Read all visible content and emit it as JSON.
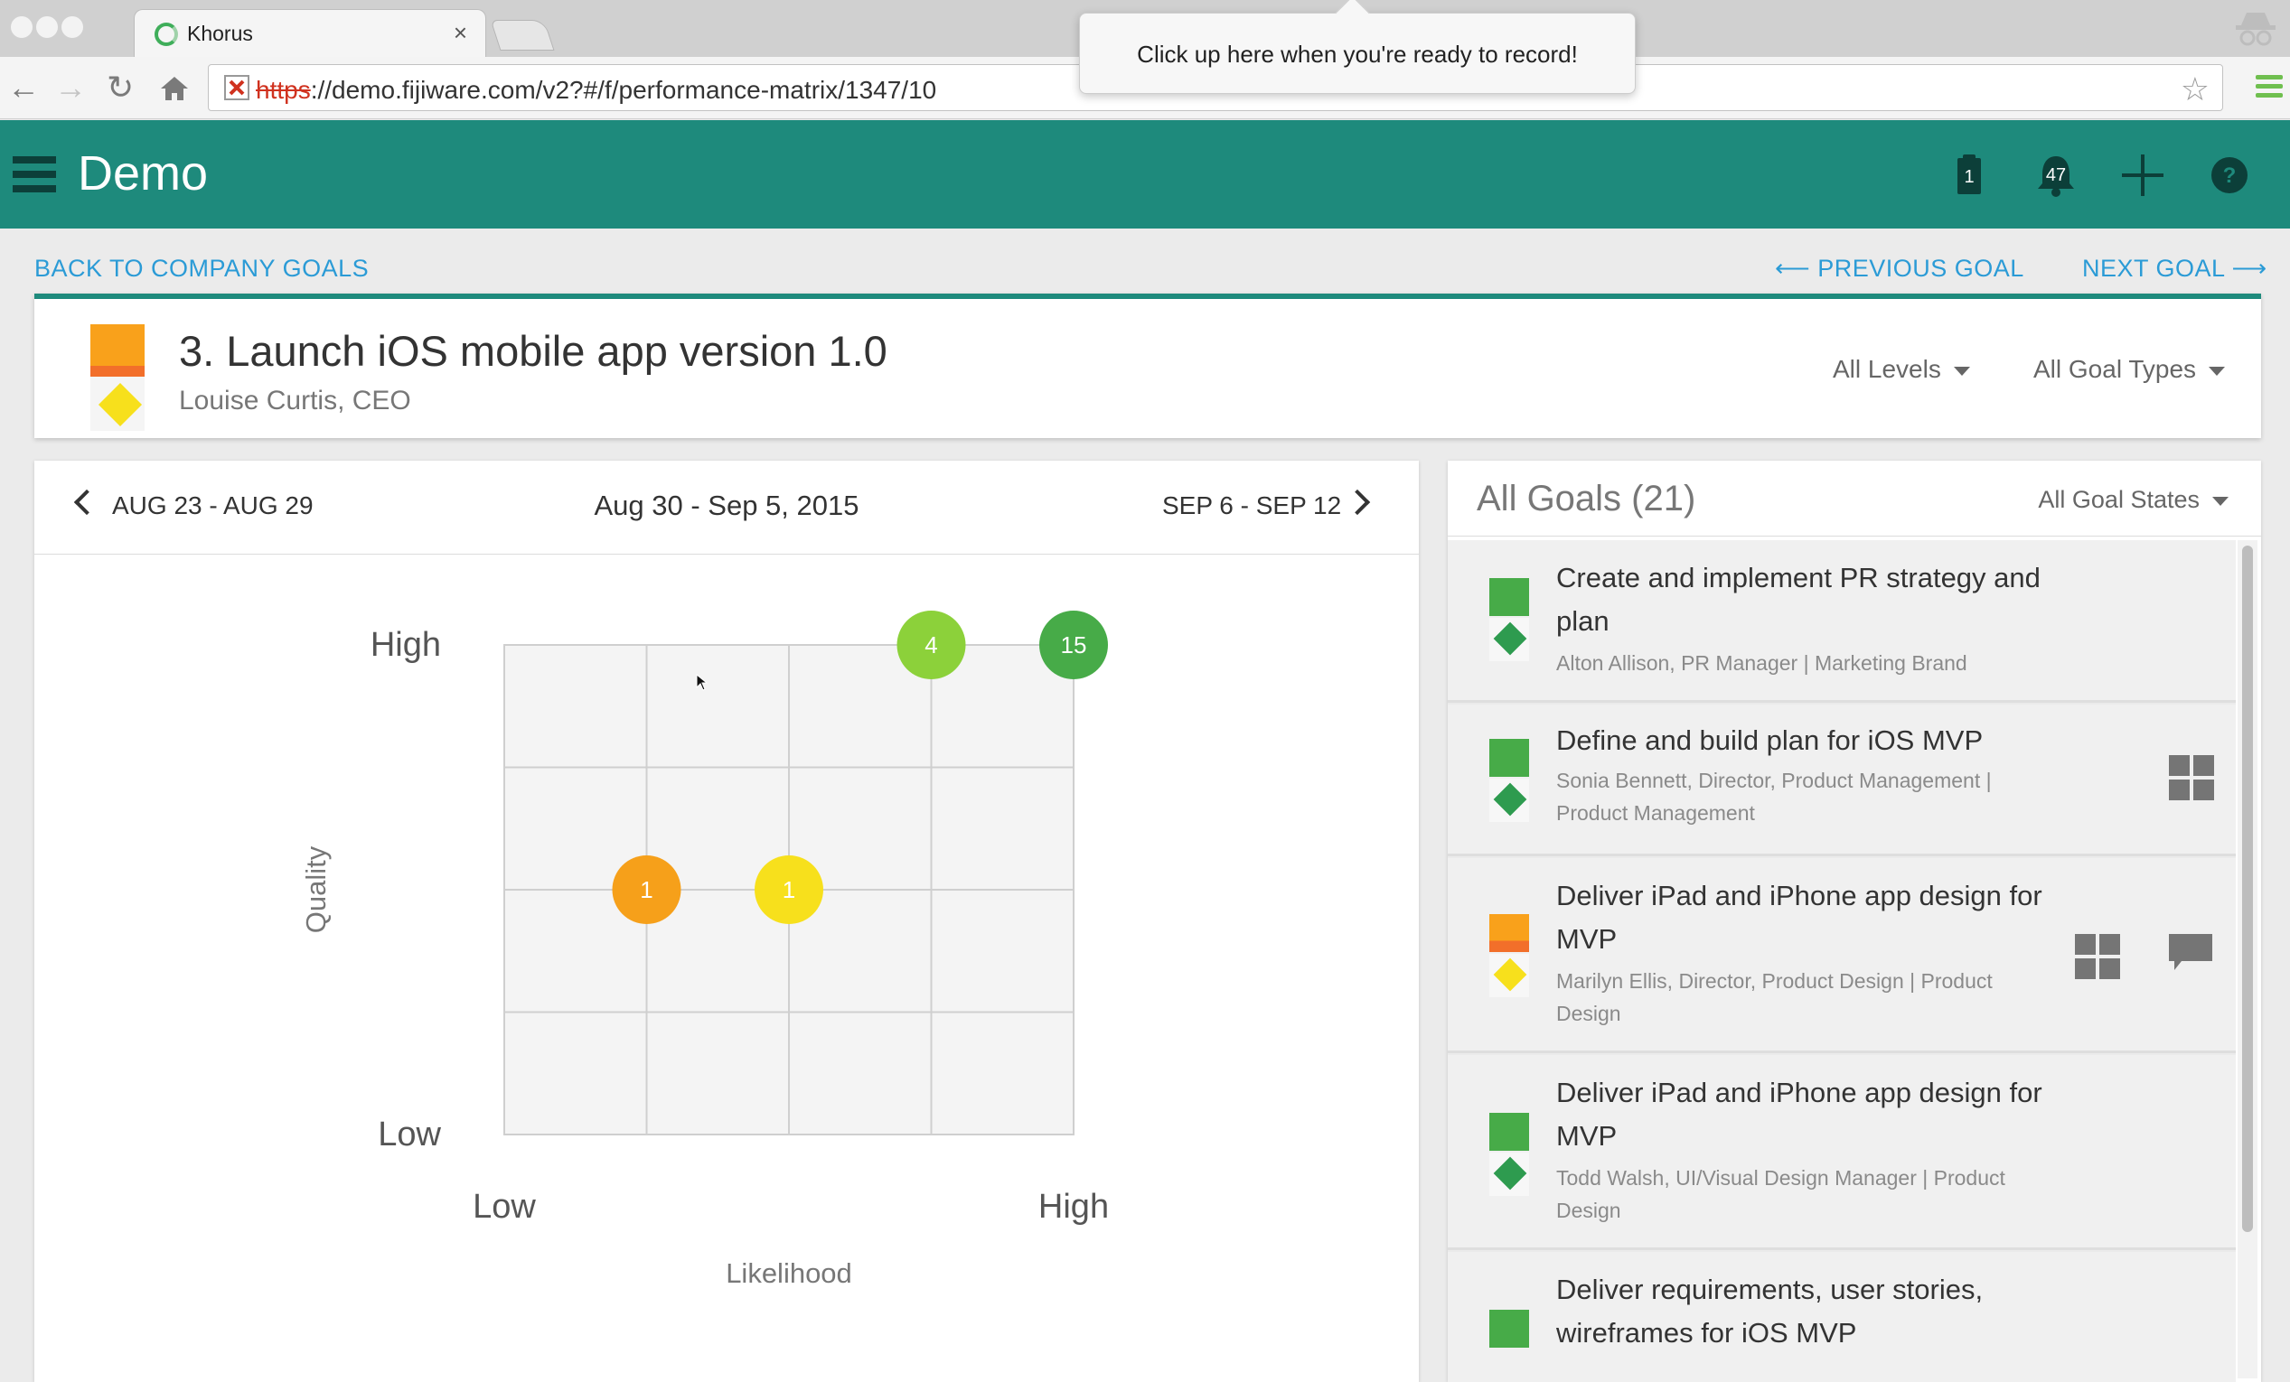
{
  "browser": {
    "tab_title": "Khorus",
    "tab_close": "×",
    "url_scheme": "https",
    "url_rest": "://demo.fijiware.com/v2?#/f/performance-matrix/1347/10",
    "tooltip": "Click up here when you're ready to record!"
  },
  "app": {
    "title": "Demo",
    "clipboard_badge": "1",
    "notifications_badge": "47"
  },
  "nav": {
    "back": "BACK TO COMPANY GOALS",
    "previous": "⟵ PREVIOUS GOAL",
    "next": "NEXT GOAL ⟶"
  },
  "goal": {
    "title": "3. Launch iOS mobile app version 1.0",
    "owner": "Louise Curtis, CEO",
    "levels_filter": "All Levels",
    "types_filter": "All Goal Types"
  },
  "week": {
    "previous": "AUG 23 - AUG 29",
    "current": "Aug 30 - Sep 5, 2015",
    "next": "SEP 6 - SEP 12"
  },
  "chart_data": {
    "type": "scatter",
    "title": "",
    "xlabel": "Likelihood",
    "ylabel": "Quality",
    "x_tick_labels": [
      "Low",
      "High"
    ],
    "y_tick_labels": [
      "Low",
      "High"
    ],
    "xlim": [
      0,
      4
    ],
    "ylim": [
      0,
      4
    ],
    "grid": true,
    "points": [
      {
        "x": 3,
        "y": 4,
        "label": "4",
        "color": "#8cd13a"
      },
      {
        "x": 4,
        "y": 4,
        "label": "15",
        "color": "#47ab48"
      },
      {
        "x": 1,
        "y": 2,
        "label": "1",
        "color": "#f6a01a"
      },
      {
        "x": 2,
        "y": 2,
        "label": "1",
        "color": "#f7e01c"
      }
    ]
  },
  "goals_list": {
    "title": "All Goals (21)",
    "states_filter": "All Goal States",
    "items": [
      {
        "title": "Create and implement PR strategy and plan",
        "subtitle": "Alton Allison, PR Manager | Marketing Brand",
        "status_color": "#47ab48",
        "confidence_color": "#2e9b4f"
      },
      {
        "title": "Define and build plan for iOS MVP",
        "subtitle": "Sonia Bennett, Director, Product Management | Product Management",
        "status_color": "#47ab48",
        "confidence_color": "#2e9b4f"
      },
      {
        "title": "Deliver iPad and iPhone app design for MVP",
        "subtitle": "Marilyn Ellis, Director, Product Design | Product Design",
        "status_color": "#f9a11b",
        "confidence_color": "#f7e01c"
      },
      {
        "title": "Deliver iPad and iPhone app design for MVP",
        "subtitle": "Todd Walsh, UI/Visual Design Manager | Product Design",
        "status_color": "#47ab48",
        "confidence_color": "#2e9b4f"
      },
      {
        "title": "Deliver requirements, user stories, wireframes for iOS MVP",
        "subtitle": "",
        "status_color": "#47ab48",
        "confidence_color": "#2e9b4f"
      }
    ]
  },
  "icons": {
    "hamburger": "hamburger-icon",
    "clipboard": "clipboard-icon",
    "bell": "bell-icon",
    "add": "add-icon",
    "help": "help-icon",
    "grid": "grid-icon",
    "chat": "chat-icon"
  },
  "colors": {
    "appbar": "#1e8a7c",
    "link": "#2b9bd6"
  }
}
